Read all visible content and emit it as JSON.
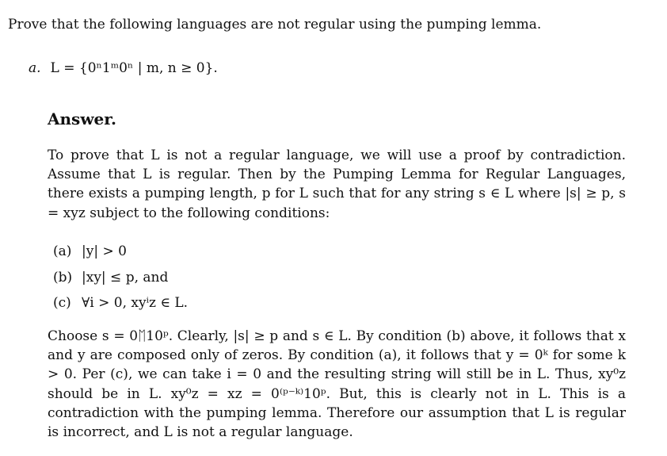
{
  "intro": "Prove that the following languages are not regular using the pumping lemma.",
  "problem": {
    "label": "a.",
    "statement": "L = {0ⁿ1ᵐ0ⁿ | m, n ≥ 0}."
  },
  "answer": {
    "heading": "Answer.",
    "paragraph1": "To prove that L is not a regular language, we will use a proof by contradiction. Assume that L is regular. Then by the Pumping Lemma for Regular Languages, there exists a pumping length, p for L such that for any string s ∈ L where |s| ≥ p, s = xyz subject to the following conditions:",
    "conditions": [
      {
        "label": "(a)",
        "text": "|y| > 0"
      },
      {
        "label": "(b)",
        "text": "|xy| ≤ p, and"
      },
      {
        "label": "(c)",
        "text": "∀i > 0, xyⁱz ∈ L."
      }
    ],
    "paragraph2": "Choose s = 0ᛖ10ᵖ. Clearly, |s| ≥ p and s ∈ L. By condition (b) above, it follows that x and y are composed only of zeros. By condition (a), it follows that y = 0ᵏ for some k > 0. Per (c), we can take i = 0 and the resulting string will still be in L. Thus, xy⁰z should be in L. xy⁰z = xz = 0⁽ᵖ⁻ᵏ⁾10ᵖ. But, this is clearly not in L. This is a contradiction with the pumping lemma. Therefore our assumption that L is regular is incorrect, and L is not a regular language."
  }
}
